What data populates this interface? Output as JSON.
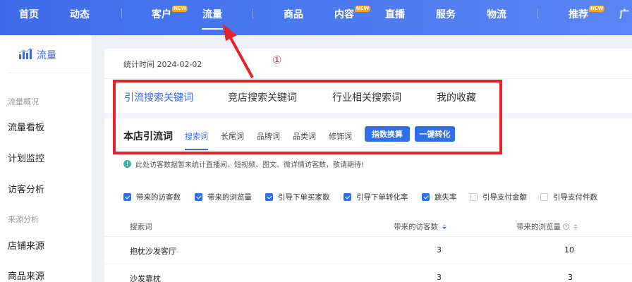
{
  "topnav": {
    "items": [
      {
        "label": "首页"
      },
      {
        "label": "动态"
      },
      {
        "label": "客户",
        "badge": "NEW"
      },
      {
        "label": "流量"
      },
      {
        "label": "商品"
      },
      {
        "label": "内容",
        "badge": "NEW"
      },
      {
        "label": "直播"
      },
      {
        "label": "服务"
      },
      {
        "label": "物流"
      },
      {
        "label": "推荐",
        "badge": "NEW"
      },
      {
        "label": "广"
      }
    ],
    "active": "流量"
  },
  "sidebar": {
    "title": "流量",
    "groups": [
      {
        "label": "流量概况",
        "items": [
          "流量看板",
          "计划监控",
          "访客分析"
        ]
      },
      {
        "label": "来源分析",
        "items": [
          "店铺来源",
          "商品来源"
        ]
      }
    ]
  },
  "main": {
    "stat_time": "统计时间 2024-02-02",
    "tabs": [
      {
        "label": "引流搜索关键词",
        "active": true
      },
      {
        "label": "竞店搜索关键词"
      },
      {
        "label": "行业相关搜索词"
      },
      {
        "label": "我的收藏"
      }
    ],
    "subrow": {
      "title": "本店引流词",
      "chips": [
        {
          "label": "搜索词",
          "active": true
        },
        {
          "label": "长尾词"
        },
        {
          "label": "品牌词"
        },
        {
          "label": "品类词"
        },
        {
          "label": "修饰词"
        }
      ],
      "buttons": [
        "指数换算",
        "一键转化"
      ]
    },
    "notice": "此处访客数据暂未统计直播间、短视频、图文、微详情访客数，敬请期待!",
    "metrics": [
      {
        "label": "带来的访客数",
        "checked": true
      },
      {
        "label": "带来的浏览量",
        "checked": true
      },
      {
        "label": "引导下单买家数",
        "checked": true
      },
      {
        "label": "引导下单转化率",
        "checked": true
      },
      {
        "label": "跳失率",
        "checked": true
      },
      {
        "label": "引导支付金额",
        "checked": false
      },
      {
        "label": "引导支付件数",
        "checked": false
      }
    ],
    "table": {
      "headers": [
        "搜索词",
        "带来的访客数",
        "带来的浏览量"
      ],
      "rows": [
        [
          "抱枕沙发客厅",
          "3",
          "10"
        ],
        [
          "沙发靠枕",
          "3",
          "3"
        ]
      ]
    }
  },
  "annotation": {
    "marker": "①",
    "color": "#e5232a"
  }
}
